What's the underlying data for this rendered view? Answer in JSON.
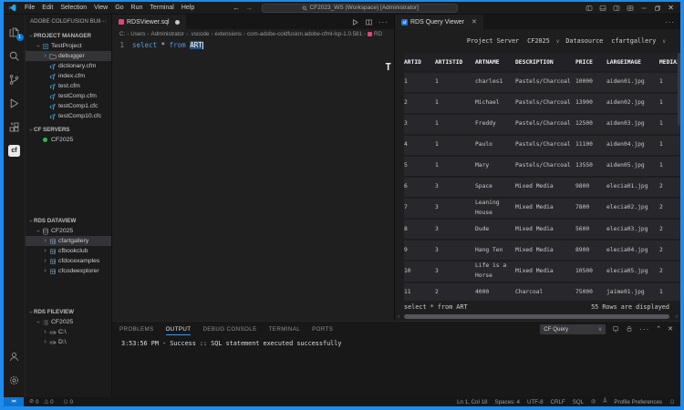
{
  "colors": {
    "accent_blue": "#1d8ced",
    "remote_blue": "#0d73cf",
    "success_green": "#3cb34f",
    "file_icon_pink": "#e0457b",
    "cf_icon_teal": "#41b0ea",
    "tab_icon_blue": "#1f6fd0",
    "panel_tab_underline": "#4098e8",
    "selection_blue": "#264f78",
    "keyword_blue": "#569cd6"
  },
  "titlebar": {
    "menus": [
      "File",
      "Edit",
      "Selection",
      "View",
      "Go",
      "Run",
      "Terminal",
      "Help"
    ],
    "command_center": "CF2023_WS (Workspace) [Administrator]"
  },
  "activity_bar": {
    "items": [
      {
        "name": "explorer",
        "badge": "1"
      },
      {
        "name": "search"
      },
      {
        "name": "source-control"
      },
      {
        "name": "run-debug"
      },
      {
        "name": "extensions"
      },
      {
        "name": "coldfusion",
        "active": true
      }
    ],
    "bottom": [
      {
        "name": "account"
      },
      {
        "name": "settings"
      }
    ]
  },
  "sidebar": {
    "title": "ADOBE COLDFUSION BUIL...",
    "more": "···",
    "tree": [
      {
        "kind": "section",
        "label": "PROJECT MANAGER"
      },
      {
        "kind": "item",
        "label": "TestProject",
        "icon": "project",
        "depth": 1,
        "twist": "open"
      },
      {
        "kind": "item",
        "label": "debugger",
        "icon": "folder",
        "depth": 2,
        "twist": "closed",
        "selected": true
      },
      {
        "kind": "item",
        "label": "dictionary.cfm",
        "icon": "cf",
        "depth": 2
      },
      {
        "kind": "item",
        "label": "index.cfm",
        "icon": "cf",
        "depth": 2
      },
      {
        "kind": "item",
        "label": "test.cfm",
        "icon": "cf",
        "depth": 2
      },
      {
        "kind": "item",
        "label": "testComp.cfm",
        "icon": "cf",
        "depth": 2
      },
      {
        "kind": "item",
        "label": "testComp1.cfc",
        "icon": "cf",
        "depth": 2
      },
      {
        "kind": "item",
        "label": "testComp10.cfc",
        "icon": "cf",
        "depth": 2
      },
      {
        "kind": "section",
        "label": "CF SERVERS",
        "gap": 4
      },
      {
        "kind": "item",
        "label": "CF2025",
        "icon": "server-green",
        "depth": 1
      },
      {
        "kind": "section",
        "label": "RDS DATAVIEW",
        "gap": 78
      },
      {
        "kind": "item",
        "label": "CF2025",
        "icon": "db",
        "depth": 1,
        "twist": "open"
      },
      {
        "kind": "item",
        "label": "cfartgallery",
        "icon": "table",
        "depth": 2,
        "twist": "closed",
        "selected": true
      },
      {
        "kind": "item",
        "label": "cfbookclub",
        "icon": "table",
        "depth": 2,
        "twist": "closed"
      },
      {
        "kind": "item",
        "label": "cfdocexamples",
        "icon": "table",
        "depth": 2,
        "twist": "closed"
      },
      {
        "kind": "item",
        "label": "cfcodeexplorer",
        "icon": "table",
        "depth": 2,
        "twist": "closed"
      },
      {
        "kind": "section",
        "label": "RDS FILEVIEW",
        "gap": 34
      },
      {
        "kind": "item",
        "label": "CF2025",
        "icon": "list",
        "depth": 1,
        "twist": "open"
      },
      {
        "kind": "item",
        "label": "C:\\",
        "icon": "drive",
        "depth": 2,
        "twist": "closed"
      },
      {
        "kind": "item",
        "label": "D:\\",
        "icon": "drive",
        "depth": 2,
        "twist": "closed"
      }
    ]
  },
  "editor": {
    "tab": {
      "label": "RDSViewer.sql",
      "modified": true
    },
    "breadcrumb": [
      "C:",
      "Users",
      "Administrator",
      ".vscode",
      "extensions",
      "com-adobe-coldfusion.adobe-cfml-lsp-1.0.581",
      "RD"
    ],
    "code": {
      "line_number": "1",
      "tokens": [
        {
          "t": "select",
          "c": "kw"
        },
        {
          "t": " ",
          "c": "pl"
        },
        {
          "t": "*",
          "c": "op"
        },
        {
          "t": " ",
          "c": "pl"
        },
        {
          "t": "from",
          "c": "kw"
        },
        {
          "t": " ",
          "c": "pl"
        },
        {
          "t": "ART",
          "c": "sel"
        }
      ]
    },
    "artifact": "T"
  },
  "query_viewer": {
    "tab": "RDS Query Viewer",
    "more": "···",
    "toolbar": {
      "project_server_label": "Project Server",
      "project_server_value": "CF2025",
      "datasource_label": "Datasource",
      "datasource_value": "cfartgallery"
    },
    "table": {
      "columns": [
        "ARTID",
        "ARTISTID",
        "ARTNAME",
        "DESCRIPTION",
        "PRICE",
        "LARGEIMAGE",
        "MEDIAID"
      ],
      "rows": [
        [
          "1",
          "1",
          "charles1",
          "Pastels/Charcoal",
          "10000",
          "aiden01.jpg",
          "1"
        ],
        [
          "2",
          "1",
          "Michael",
          "Pastels/Charcoal",
          "13900",
          "aiden02.jpg",
          "1"
        ],
        [
          "3",
          "1",
          "Freddy",
          "Pastels/Charcoal",
          "12500",
          "aiden03.jpg",
          "1"
        ],
        [
          "4",
          "1",
          "Paulo",
          "Pastels/Charcoal",
          "11100",
          "aiden04.jpg",
          "1"
        ],
        [
          "5",
          "1",
          "Mary",
          "Pastels/Charcoal",
          "13550",
          "aiden05.jpg",
          "1"
        ],
        [
          "6",
          "3",
          "Space",
          "Mixed Media",
          "9800",
          "elecia01.jpg",
          "2"
        ],
        [
          "7",
          "3",
          "Leaning House",
          "Mixed Media",
          "7800",
          "elecia02.jpg",
          "2"
        ],
        [
          "8",
          "3",
          "Dude",
          "Mixed Media",
          "5600",
          "elecia03.jpg",
          "2"
        ],
        [
          "9",
          "3",
          "Hang Ten",
          "Mixed Media",
          "8900",
          "elecia04.jpg",
          "2"
        ],
        [
          "10",
          "3",
          "Life is a Horse",
          "Mixed Media",
          "10500",
          "elecia05.jpg",
          "2"
        ],
        [
          "11",
          "2",
          "4000",
          "Charcoal",
          "75000",
          "jaime01.jpg",
          "1"
        ]
      ]
    },
    "status_query": "select * from ART",
    "status_rows": "55 Rows are displayed"
  },
  "panel": {
    "tabs": [
      "PROBLEMS",
      "OUTPUT",
      "DEBUG CONSOLE",
      "TERMINAL",
      "PORTS"
    ],
    "active_tab": "OUTPUT",
    "channel": "CF Query",
    "output": "3:53:56 PM - Success :: SQL statement executed successfully"
  },
  "status_bar": {
    "errors": "0",
    "warnings": "0",
    "bell_count": "0",
    "items": [
      "Ln 1, Col 18",
      "Spaces: 4",
      "UTF-8",
      "CRLF",
      "SQL"
    ],
    "profile": "Profile Preferences"
  }
}
